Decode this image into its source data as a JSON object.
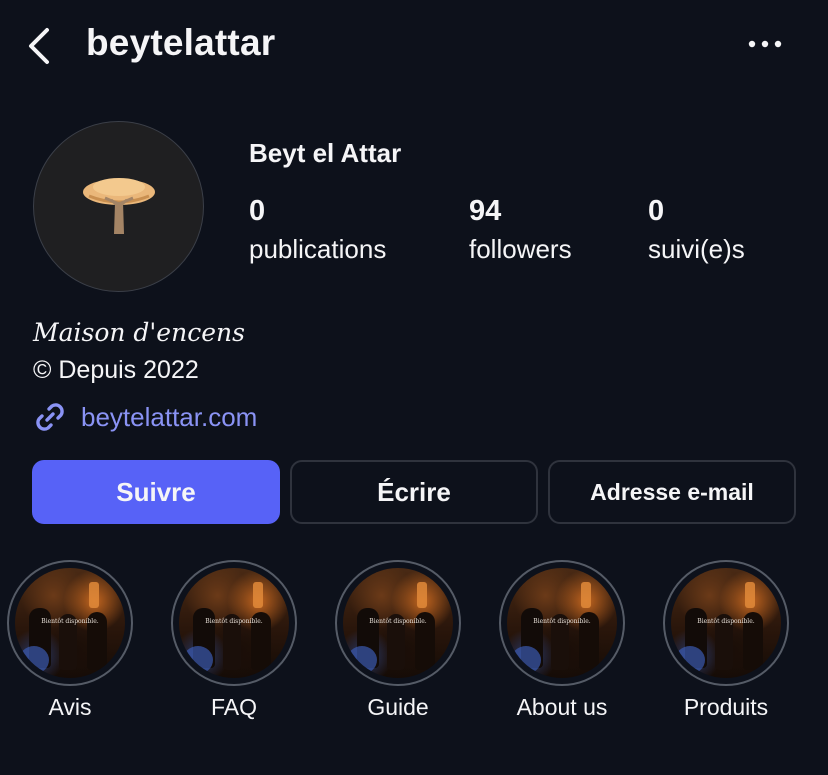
{
  "header": {
    "username": "beytelattar",
    "back_icon": "chevron-left-icon",
    "more_icon": "more-horizontal-icon"
  },
  "profile": {
    "display_name": "Beyt el Attar",
    "avatar_icon": "tree-logo-icon",
    "stats": {
      "posts": {
        "value": "0",
        "label": "publications"
      },
      "followers": {
        "value": "94",
        "label": "followers"
      },
      "following": {
        "value": "0",
        "label": "suivi(e)s"
      }
    },
    "bio": {
      "line1": "Maison d'encens",
      "line2": "© Depuis 2022"
    },
    "link": {
      "icon": "link-icon",
      "text": "beytelattar.com"
    }
  },
  "actions": {
    "follow_label": "Suivre",
    "message_label": "Écrire",
    "email_label": "Adresse e-mail"
  },
  "highlights": [
    {
      "label": "Avis",
      "overlay": "Bientôt disponible."
    },
    {
      "label": "FAQ",
      "overlay": "Bientôt disponible."
    },
    {
      "label": "Guide",
      "overlay": "Bientôt disponible."
    },
    {
      "label": "About us",
      "overlay": "Bientôt disponible."
    },
    {
      "label": "Produits",
      "overlay": "Bientôt disponible."
    }
  ],
  "colors": {
    "background": "#0d111b",
    "primary_button": "#5762f7",
    "link": "#8a93f5",
    "text": "#f5f5f7"
  }
}
